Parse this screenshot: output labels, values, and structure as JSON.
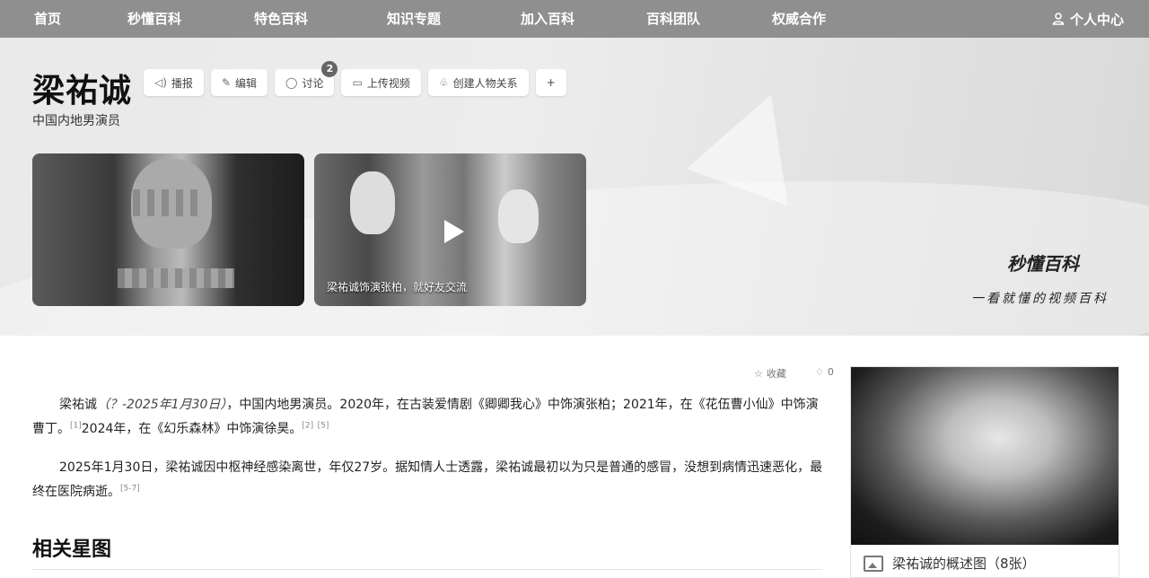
{
  "nav": {
    "items": [
      "首页",
      "秒懂百科",
      "特色百科",
      "知识专题",
      "加入百科",
      "百科团队",
      "权威合作"
    ],
    "user_label": "个人中心"
  },
  "entry": {
    "title": "梁祐诚",
    "subtitle": "中国内地男演员",
    "actions": [
      {
        "label": "播报",
        "icon": "speaker-icon"
      },
      {
        "label": "编辑",
        "icon": "pencil-icon"
      },
      {
        "label": "讨论",
        "icon": "chat-icon",
        "badge": "2"
      },
      {
        "label": "上传视频",
        "icon": "video-icon"
      },
      {
        "label": "创建人物关系",
        "icon": "relation-icon"
      }
    ],
    "add_label": "+"
  },
  "media": {
    "video_caption": "梁祐诚饰演张柏，就好友交流"
  },
  "brand": {
    "name": "秒懂百科",
    "slogan": "一看就懂的视频百科"
  },
  "toolbar": {
    "favorite_label": "收藏",
    "share_count": "0"
  },
  "content": {
    "para1": {
      "name": "梁祐诚",
      "dates": "（？-2025年1月30日）",
      "text_a": "，中国内地男演员。2020年，在古装爱情剧《卿卿我心》中饰演张柏；2021年，在《花伍曹小仙》中饰演曹丁。",
      "ref1": "[1]",
      "text_b": "2024年，在《幻乐森林》中饰演徐昊。",
      "ref2": "[2]",
      "ref3": "[5]"
    },
    "para2": {
      "text": "2025年1月30日，梁祐诚因中枢神经感染离世，年仅27岁。据知情人士透露，梁祐诚最初以为只是普通的感冒，没想到病情迅速恶化，最终在医院病逝。",
      "ref": "[5-7]"
    },
    "section_title": "相关星图"
  },
  "side": {
    "caption": "梁祐诚的概述图（8张）"
  }
}
